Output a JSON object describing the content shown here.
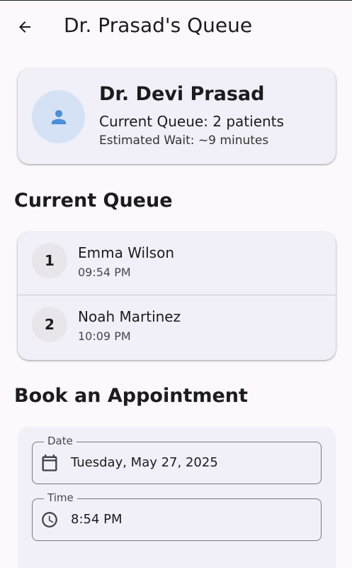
{
  "appbar": {
    "title": "Dr. Prasad's Queue",
    "back_icon": "arrow-back-icon"
  },
  "doctor": {
    "avatar_icon": "person-icon",
    "name": "Dr. Devi Prasad",
    "current_queue": "Current Queue: 2 patients",
    "estimated_wait": "Estimated Wait: ~9 minutes"
  },
  "queue": {
    "section_title": "Current Queue",
    "patients": [
      {
        "position": "1",
        "name": "Emma Wilson",
        "time": "09:54 PM"
      },
      {
        "position": "2",
        "name": "Noah Martinez",
        "time": "10:09 PM"
      }
    ]
  },
  "booking": {
    "section_title": "Book an Appointment",
    "date_label": "Date",
    "date_value": "Tuesday, May 27, 2025",
    "date_icon": "calendar-icon",
    "time_label": "Time",
    "time_value": "8:54 PM",
    "time_icon": "clock-icon"
  },
  "colors": {
    "background": "#fcf8fc",
    "card": "#f1f0f8",
    "avatar_bg": "#d5e2f6",
    "accent": "#4a8fd9",
    "badge_bg": "#e8e6ea"
  }
}
